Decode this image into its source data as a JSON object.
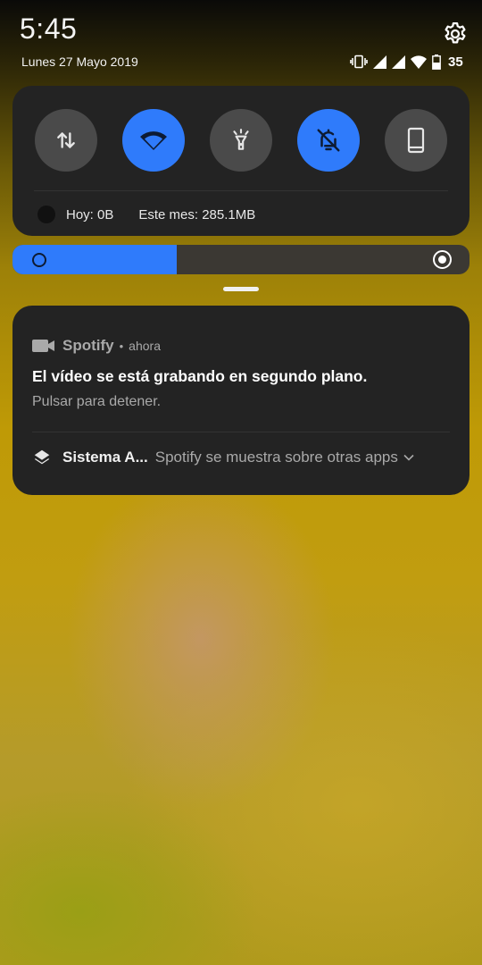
{
  "status_bar": {
    "time": "5:45",
    "date": "Lunes 27 Mayo 2019",
    "battery_level": "35",
    "icons": [
      "vibrate-icon",
      "signal-icon",
      "signal-icon",
      "wifi-icon",
      "battery-icon"
    ]
  },
  "quick_settings": {
    "tiles": [
      {
        "name": "mobile-data",
        "icon": "data-transfer-icon",
        "active": false
      },
      {
        "name": "wifi",
        "icon": "wifi-icon",
        "active": true
      },
      {
        "name": "flashlight",
        "icon": "flashlight-icon",
        "active": false
      },
      {
        "name": "do-not-disturb",
        "icon": "bell-off-icon",
        "active": true
      },
      {
        "name": "screen",
        "icon": "phone-icon",
        "active": false
      }
    ],
    "usage_today": "Hoy: 0B",
    "usage_month": "Este mes: 285.1MB"
  },
  "brightness": {
    "level_fraction": 0.36,
    "auto": true
  },
  "notification": {
    "app_icon": "video-camera-icon",
    "app_name": "Spotify",
    "separator": "•",
    "time": "ahora",
    "title": "El vídeo se está grabando en segundo plano.",
    "text": "Pulsar para detener.",
    "secondary_icon": "layers-icon",
    "secondary_name": "Sistema A...",
    "secondary_text": "Spotify se muestra sobre otras apps"
  },
  "colors": {
    "accent": "#2f7bfb",
    "panel": "#232323",
    "tile_inactive": "#4a4a4a",
    "secondary_text": "#a9a9a9"
  }
}
